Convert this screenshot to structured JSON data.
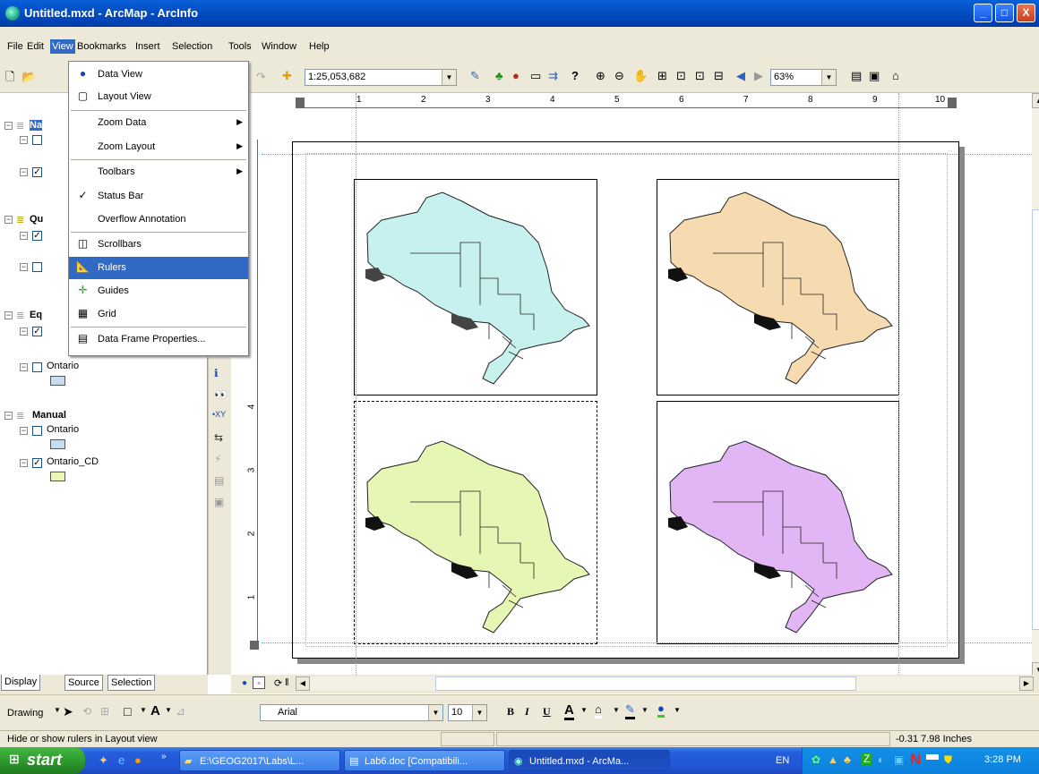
{
  "window": {
    "title": "Untitled.mxd - ArcMap - ArcInfo",
    "buttons": [
      "_",
      "□",
      "X"
    ]
  },
  "menubar": [
    "File",
    "Edit",
    "View",
    "Bookmarks",
    "Insert",
    "Selection",
    "Tools",
    "Window",
    "Help"
  ],
  "toolbar": {
    "scale": "1:25,053,682",
    "zoom": "63%"
  },
  "view_menu": {
    "items": [
      {
        "label": "Data View",
        "icon": "globe-icon"
      },
      {
        "label": "Layout View",
        "icon": "layout-page-icon"
      },
      {
        "label": "Zoom Data",
        "submenu": true
      },
      {
        "label": "Zoom Layout",
        "submenu": true
      },
      {
        "label": "Toolbars",
        "submenu": true
      },
      {
        "label": "Status Bar",
        "checked": true
      },
      {
        "label": "Overflow Annotation"
      },
      {
        "label": "Scrollbars",
        "icon": "scrollbars-icon"
      },
      {
        "label": "Rulers",
        "icon": "rulers-icon",
        "highlighted": true
      },
      {
        "label": "Guides",
        "icon": "guides-icon"
      },
      {
        "label": "Grid",
        "icon": "grid-icon"
      },
      {
        "label": "Data Frame Properties...",
        "icon": "properties-icon"
      }
    ]
  },
  "toc": {
    "groups": [
      {
        "name": "Na"
      },
      {
        "name": "Qu"
      },
      {
        "name": "Eq"
      },
      {
        "name": "Manual"
      }
    ],
    "layers": {
      "ontario_eq": "Ontario",
      "ontario_manual": "Ontario",
      "ontario_cd": "Ontario_CD"
    },
    "tabs": [
      "Display",
      "Source",
      "Selection"
    ]
  },
  "ruler": {
    "h_ticks": [
      "1",
      "2",
      "3",
      "4",
      "5",
      "6",
      "7",
      "8",
      "9",
      "10"
    ],
    "v_ticks": [
      "4",
      "3",
      "2",
      "1"
    ]
  },
  "map_colors": {
    "frame1": "#c6f1ef",
    "frame2": "#f6dbb0",
    "frame3": "#e6f6b4",
    "frame4": "#e2b6f4"
  },
  "drawing_toolbar": {
    "drawing_label": "Drawing",
    "font": "Arial",
    "size": "10",
    "bold": "B",
    "italic": "I",
    "underline": "U",
    "font_color_glyph": "A"
  },
  "status": {
    "message": "Hide or show rulers in Layout view",
    "coords": "-0.31  7.98 Inches"
  },
  "taskbar": {
    "start": "start",
    "tasks": [
      "E:\\GEOG2017\\Labs\\L...",
      "Lab6.doc [Compatibili...",
      "Untitled.mxd - ArcMa..."
    ],
    "lang": "EN",
    "clock": "3:28 PM"
  }
}
